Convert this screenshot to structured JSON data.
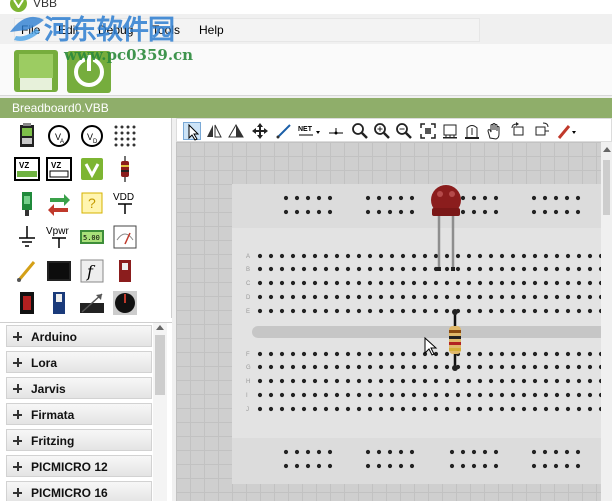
{
  "window": {
    "title": "VBB"
  },
  "watermark": {
    "title": "河东软件园",
    "url": "www.pc0359.cn"
  },
  "menu": [
    "File",
    "Edit",
    "Debug",
    "Tools",
    "Help"
  ],
  "document": {
    "tab_label": "Breadboard0.VBB"
  },
  "palette_icons": [
    "battery-icon",
    "voltmeter-icon",
    "ammeter-icon",
    "led-matrix-icon",
    "vz-shield-icon",
    "vz-ee-icon",
    "vbb-logo-icon",
    "resistor-icon",
    "green-led-icon",
    "swap-icon",
    "question-icon",
    "vdd-icon",
    "ground-icon",
    "vpwr-icon",
    "lcd-display-icon",
    "analog-meter-icon",
    "probe-icon",
    "oscilloscope-icon",
    "function-generator-icon",
    "switch-icon",
    "red-button-icon",
    "blue-switch-icon",
    "slide-potentiometer-icon",
    "knob-icon"
  ],
  "palette_text": {
    "vdd": "VDD",
    "vpwr": "Vpwr",
    "lcd": "5.00"
  },
  "libraries": [
    "Arduino",
    "Lora",
    "Jarvis",
    "Firmata",
    "Fritzing",
    "PICMICRO 12",
    "PICMICRO 16"
  ],
  "toolbar2": {
    "net_label": "NET"
  },
  "breadboard": {
    "row_labels": [
      "A",
      "B",
      "C",
      "D",
      "E",
      "F",
      "G",
      "H",
      "I",
      "J"
    ]
  },
  "colors": {
    "accent_green": "#8fae6a",
    "led_red": "#8b1d1d",
    "breadboard": "#e3e3e3"
  }
}
